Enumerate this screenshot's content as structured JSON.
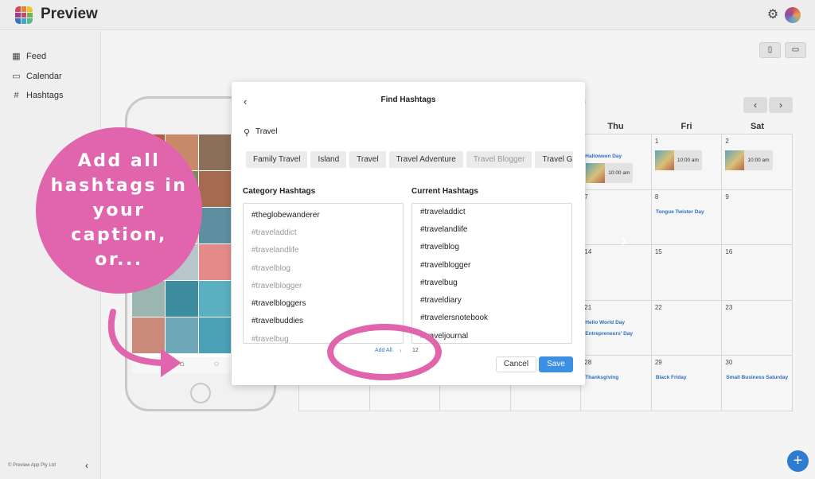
{
  "app": {
    "title": "Preview"
  },
  "colors": {
    "accent": "#3d8fe3",
    "annotation": "#e065ad",
    "event_text": "#2f6fbf"
  },
  "sidebar": {
    "items": [
      {
        "icon": "grid-icon",
        "label": "Feed"
      },
      {
        "icon": "calendar-icon",
        "label": "Calendar"
      },
      {
        "icon": "hashtag-icon",
        "label": "Hashtags"
      }
    ],
    "copyright": "© Preview App Pty Ltd"
  },
  "calendar": {
    "month_fragment": "9",
    "headers": [
      "Thu",
      "Fri",
      "Sat"
    ],
    "cells": [
      {
        "day": "",
        "event": "Halloween Day",
        "post_time": "10:00 am"
      },
      {
        "day": "1",
        "post_time": "10:00 am"
      },
      {
        "day": "2",
        "post_time": "10:00 am"
      },
      {
        "day": "7"
      },
      {
        "day": "8",
        "event": "Tongue Twister Day"
      },
      {
        "day": "9"
      },
      {
        "day": "14"
      },
      {
        "day": "15"
      },
      {
        "day": "16"
      },
      {
        "day": "21",
        "event": "Hello World Day",
        "event2": "Entrepreneurs' Day"
      },
      {
        "day": "22"
      },
      {
        "day": "23"
      },
      {
        "day": "28",
        "event": "Thanksgiving"
      },
      {
        "day": "29",
        "event": "Black Friday"
      },
      {
        "day": "30",
        "event": "Small Business Saturday"
      }
    ]
  },
  "annotation": {
    "text": "Add all hashtags in your caption, or..."
  },
  "modal": {
    "title": "Find Hashtags",
    "search_value": "Travel",
    "chips": [
      "Family Travel",
      "Island",
      "Travel",
      "Travel Adventure",
      "Travel Blogger",
      "Travel G"
    ],
    "category_title": "Category Hashtags",
    "current_title": "Current Hashtags",
    "category_hashtags": [
      {
        "tag": "#theglobewanderer",
        "added": false
      },
      {
        "tag": "#traveladdict",
        "added": true
      },
      {
        "tag": "#travelandlife",
        "added": true
      },
      {
        "tag": "#travelblog",
        "added": true
      },
      {
        "tag": "#travelblogger",
        "added": true
      },
      {
        "tag": "#travelbloggers",
        "added": false
      },
      {
        "tag": "#travelbuddies",
        "added": false
      },
      {
        "tag": "#travelbug",
        "added": true
      }
    ],
    "current_hashtags": [
      "#traveladdict",
      "#travelandlife",
      "#travelblog",
      "#travelblogger",
      "#travelbug",
      "#traveldiary",
      "#travelersnotebook",
      "#traveljournal"
    ],
    "add_all_label": "Add All",
    "count": "12",
    "cancel_label": "Cancel",
    "save_label": "Save"
  }
}
